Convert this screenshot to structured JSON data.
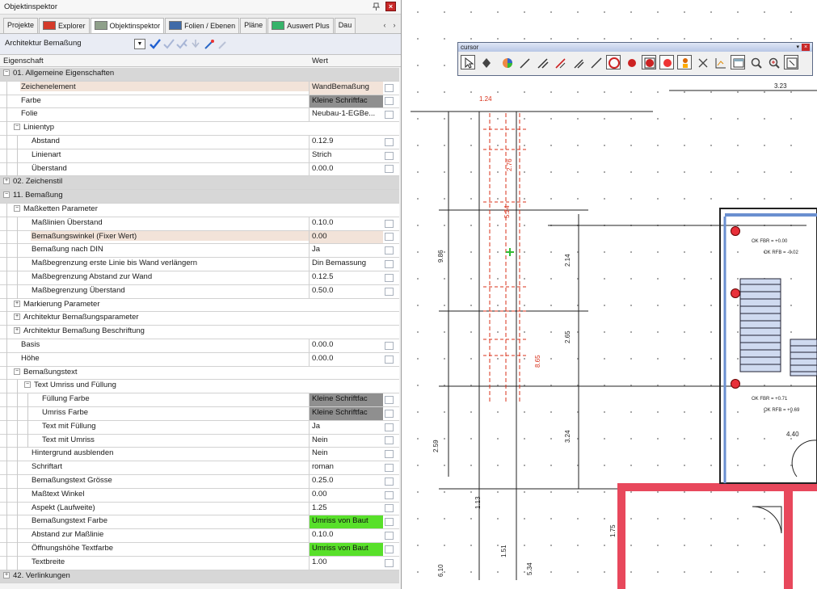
{
  "inspector": {
    "title": "Objektinspektor",
    "tabs": [
      "Projekte",
      "Explorer",
      "Objektinspektor",
      "Folien / Ebenen",
      "Pläne",
      "Auswert Plus",
      "Dau"
    ],
    "toolbar_title": "Architektur Bemaßung",
    "col_property": "Eigenschaft",
    "col_value": "Wert",
    "rows": [
      {
        "label": "01. Allgemeine Eigenschaften",
        "value": ""
      },
      {
        "label": "Zeichenelement",
        "value": "WandBemaßung"
      },
      {
        "label": "Farbe",
        "value": "Kleine Schriftfac"
      },
      {
        "label": "Folie",
        "value": "Neubau-1-EGBe..."
      },
      {
        "label": "Linientyp",
        "value": ""
      },
      {
        "label": "Abstand",
        "value": "0.12.9"
      },
      {
        "label": "Linienart",
        "value": "Strich"
      },
      {
        "label": "Überstand",
        "value": "0.00.0"
      },
      {
        "label": "02. Zeichenstil",
        "value": ""
      },
      {
        "label": "11. Bemaßung",
        "value": ""
      },
      {
        "label": "Maßketten Parameter",
        "value": ""
      },
      {
        "label": "Maßlinien Überstand",
        "value": "0.10.0"
      },
      {
        "label": "Bemaßungswinkel (Fixer Wert)",
        "value": "0.00"
      },
      {
        "label": "Bemaßung nach DIN",
        "value": "Ja"
      },
      {
        "label": "Maßbegrenzung erste Linie bis Wand verlängern",
        "value": "Din Bemassung"
      },
      {
        "label": "Maßbegrenzung Abstand zur Wand",
        "value": "0.12.5"
      },
      {
        "label": "Maßbegrenzung Überstand",
        "value": "0.50.0"
      },
      {
        "label": "Markierung Parameter",
        "value": ""
      },
      {
        "label": "Architektur Bemaßungsparameter",
        "value": ""
      },
      {
        "label": "Architektur Bemaßung Beschriftung",
        "value": ""
      },
      {
        "label": "Basis",
        "value": "0.00.0"
      },
      {
        "label": "Höhe",
        "value": "0.00.0"
      },
      {
        "label": "Bemaßungstext",
        "value": ""
      },
      {
        "label": "Text Umriss und Füllung",
        "value": ""
      },
      {
        "label": "Füllung Farbe",
        "value": "Kleine Schriftfac"
      },
      {
        "label": "Umriss Farbe",
        "value": "Kleine Schriftfac"
      },
      {
        "label": "Text mit Füllung",
        "value": "Ja"
      },
      {
        "label": "Text mit Umriss",
        "value": "Nein"
      },
      {
        "label": "Hintergrund ausblenden",
        "value": "Nein"
      },
      {
        "label": "Schriftart",
        "value": "roman"
      },
      {
        "label": "Bemaßungstext Grösse",
        "value": "0.25.0"
      },
      {
        "label": "Maßtext Winkel",
        "value": "0.00"
      },
      {
        "label": "Aspekt (Laufweite)",
        "value": "1.25"
      },
      {
        "label": "Bemaßungstext Farbe",
        "value": "Umriss von Baut"
      },
      {
        "label": "Abstand zur Maßlinie",
        "value": "0.10.0"
      },
      {
        "label": "Öffnungshöhe Textfarbe",
        "value": "Umriss von Baut"
      },
      {
        "label": "Textbreite",
        "value": "1.00"
      },
      {
        "label": "42. Verlinkungen",
        "value": ""
      }
    ]
  },
  "cursor_toolbar": {
    "title": "cursor"
  },
  "drawing": {
    "top_dim": "3.23",
    "texts": [
      "1.24",
      "2.76",
      "5.24",
      "9.86",
      "2.14",
      "8.65",
      "2.65",
      "2.59",
      "3.24",
      "4.40",
      "1.75",
      "1.51",
      "6.10",
      "5.34",
      "1.13"
    ],
    "level_labels": [
      "OK FBR = +0.00",
      "OK RFB = -0.02",
      "OK FBR = +0.71",
      "OK RFB = +0.69"
    ],
    "colors": {
      "wall_red": "#e8485c",
      "dim_red": "#d8301a",
      "dim_black": "#222222",
      "stair_blue": "#cfdaf0",
      "post_red": "#e8303a",
      "grid_dot": "#a8a8a8"
    }
  }
}
